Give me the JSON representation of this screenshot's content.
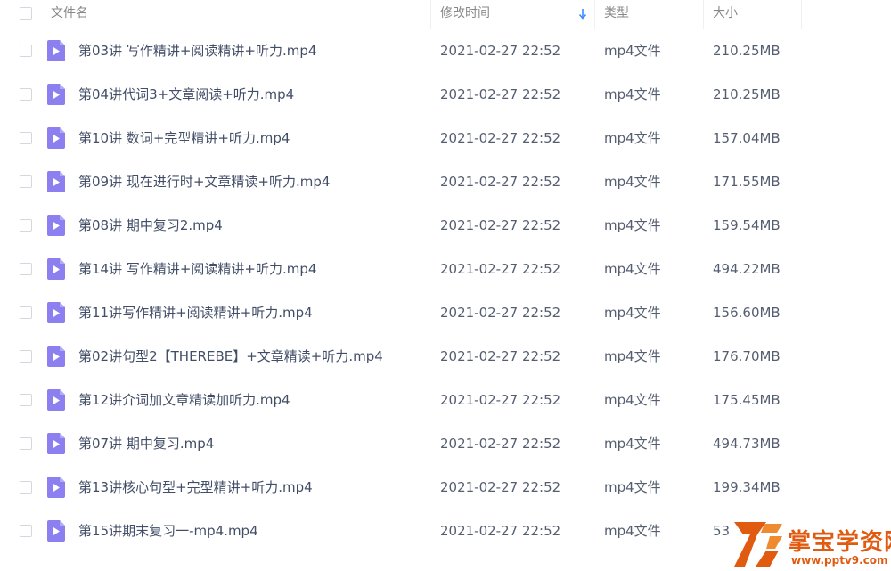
{
  "header": {
    "name": "文件名",
    "modified": "修改时间",
    "type": "类型",
    "size": "大小"
  },
  "colors": {
    "file_icon": "#8c7ff0",
    "sort_arrow": "#3b8cff",
    "watermark": "#e05a10"
  },
  "files": [
    {
      "name": "第03讲 写作精讲+阅读精讲+听力.mp4",
      "modified": "2021-02-27 22:52",
      "type": "mp4文件",
      "size": "210.25MB"
    },
    {
      "name": "第04讲代词3+文章阅读+听力.mp4",
      "modified": "2021-02-27 22:52",
      "type": "mp4文件",
      "size": "210.25MB"
    },
    {
      "name": "第10讲 数词+完型精讲+听力.mp4",
      "modified": "2021-02-27 22:52",
      "type": "mp4文件",
      "size": "157.04MB"
    },
    {
      "name": "第09讲 现在进行时+文章精读+听力.mp4",
      "modified": "2021-02-27 22:52",
      "type": "mp4文件",
      "size": "171.55MB"
    },
    {
      "name": "第08讲 期中复习2.mp4",
      "modified": "2021-02-27 22:52",
      "type": "mp4文件",
      "size": "159.54MB"
    },
    {
      "name": "第14讲 写作精讲+阅读精讲+听力.mp4",
      "modified": "2021-02-27 22:52",
      "type": "mp4文件",
      "size": "494.22MB"
    },
    {
      "name": "第11讲写作精讲+阅读精讲+听力.mp4",
      "modified": "2021-02-27 22:52",
      "type": "mp4文件",
      "size": "156.60MB"
    },
    {
      "name": "第02讲句型2【THEREBE】+文章精读+听力.mp4",
      "modified": "2021-02-27 22:52",
      "type": "mp4文件",
      "size": "176.70MB"
    },
    {
      "name": "第12讲介词加文章精读加听力.mp4",
      "modified": "2021-02-27 22:52",
      "type": "mp4文件",
      "size": "175.45MB"
    },
    {
      "name": "第07讲 期中复习.mp4",
      "modified": "2021-02-27 22:52",
      "type": "mp4文件",
      "size": "494.73MB"
    },
    {
      "name": "第13讲核心句型+完型精讲+听力.mp4",
      "modified": "2021-02-27 22:52",
      "type": "mp4文件",
      "size": "199.34MB"
    },
    {
      "name": "第15讲期末复习一-mp4.mp4",
      "modified": "2021-02-27 22:52",
      "type": "mp4文件",
      "size": "53"
    }
  ],
  "watermark": {
    "title": "掌宝学资网",
    "url": "www.pptv9.com"
  }
}
